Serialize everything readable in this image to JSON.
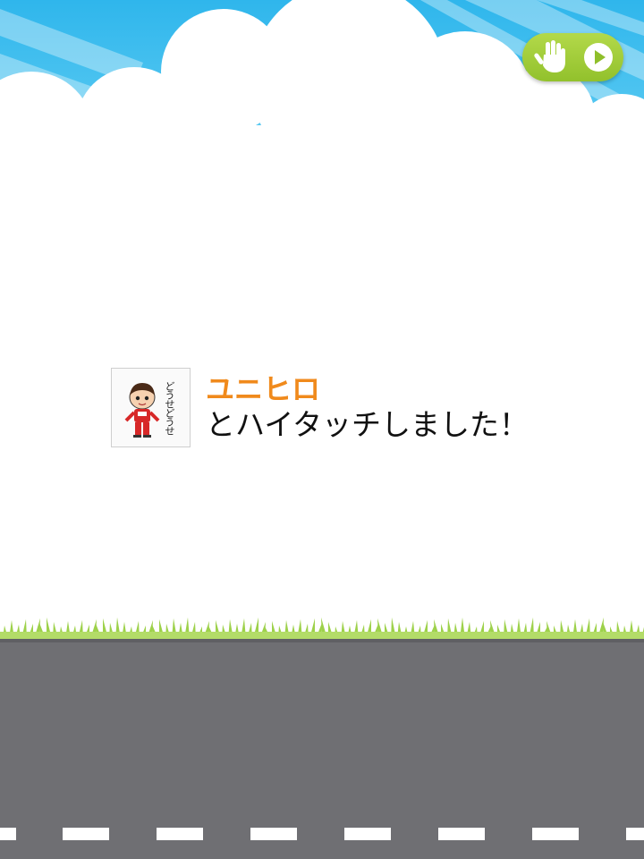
{
  "header": {
    "hightouch_button": {
      "icon": "hand-icon",
      "action_icon": "play-icon"
    }
  },
  "notification": {
    "friend_name": "ユニヒロ",
    "message": "とハイタッチしました！",
    "avatar": {
      "icon": "character-avatar",
      "side_text": "どうせどうせ"
    }
  },
  "colors": {
    "sky": "#3fc2ef",
    "button_green": "#a6cf3c",
    "name_orange": "#f08a1c",
    "road": "#6f6f73",
    "grass": "#9dd14a"
  }
}
